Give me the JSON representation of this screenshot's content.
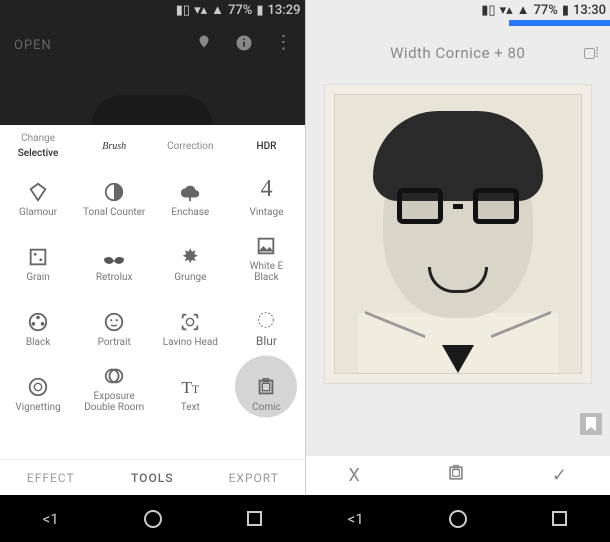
{
  "status_left": {
    "battery_pct": "77%",
    "time": "13:29"
  },
  "status_right": {
    "battery_pct": "77%",
    "time": "13:30"
  },
  "left": {
    "open_label": "OPEN",
    "header_tools": [
      {
        "top": "Change",
        "bottom": "Selective"
      },
      {
        "top": "Brush",
        "bottom": ""
      },
      {
        "top": "Correction",
        "bottom": ""
      },
      {
        "top": "HDR",
        "bottom": ""
      }
    ],
    "row1": [
      {
        "label": "Glamour",
        "icon": "diamond"
      },
      {
        "label": "Tonal Counter",
        "icon": "contrast"
      },
      {
        "label": "Enchase",
        "icon": "cloud"
      },
      {
        "label": "Vintage",
        "icon": "four"
      }
    ],
    "row2": [
      {
        "label": "Grain",
        "icon": "dice"
      },
      {
        "label": "Retrolux",
        "icon": "mustache"
      },
      {
        "label": "Grunge",
        "icon": "grunge"
      },
      {
        "label": "White E\nBlack",
        "icon": "image"
      }
    ],
    "row3": [
      {
        "label": "Black",
        "icon": "reel"
      },
      {
        "label": "Portrait",
        "icon": "face"
      },
      {
        "label": "Lavino Head",
        "icon": "scanface"
      },
      {
        "label": "Blur",
        "icon": "circle"
      }
    ],
    "row4": [
      {
        "label": "Vignetting",
        "icon": "vignette"
      },
      {
        "label": "Exposure\nDouble Room",
        "icon": "doubleexp"
      },
      {
        "label": "Text",
        "icon": "text"
      },
      {
        "label": "Comic",
        "icon": "frame",
        "selected": true
      }
    ],
    "bottom_tabs": [
      {
        "label": "EFFECT"
      },
      {
        "label": "TOOLS",
        "active": true
      },
      {
        "label": "EXPORT"
      }
    ]
  },
  "right": {
    "title": "Width Cornice + 80",
    "actions": {
      "close": "X",
      "frame": "frame",
      "confirm": "✓"
    }
  },
  "nav": {
    "back": "<1"
  }
}
